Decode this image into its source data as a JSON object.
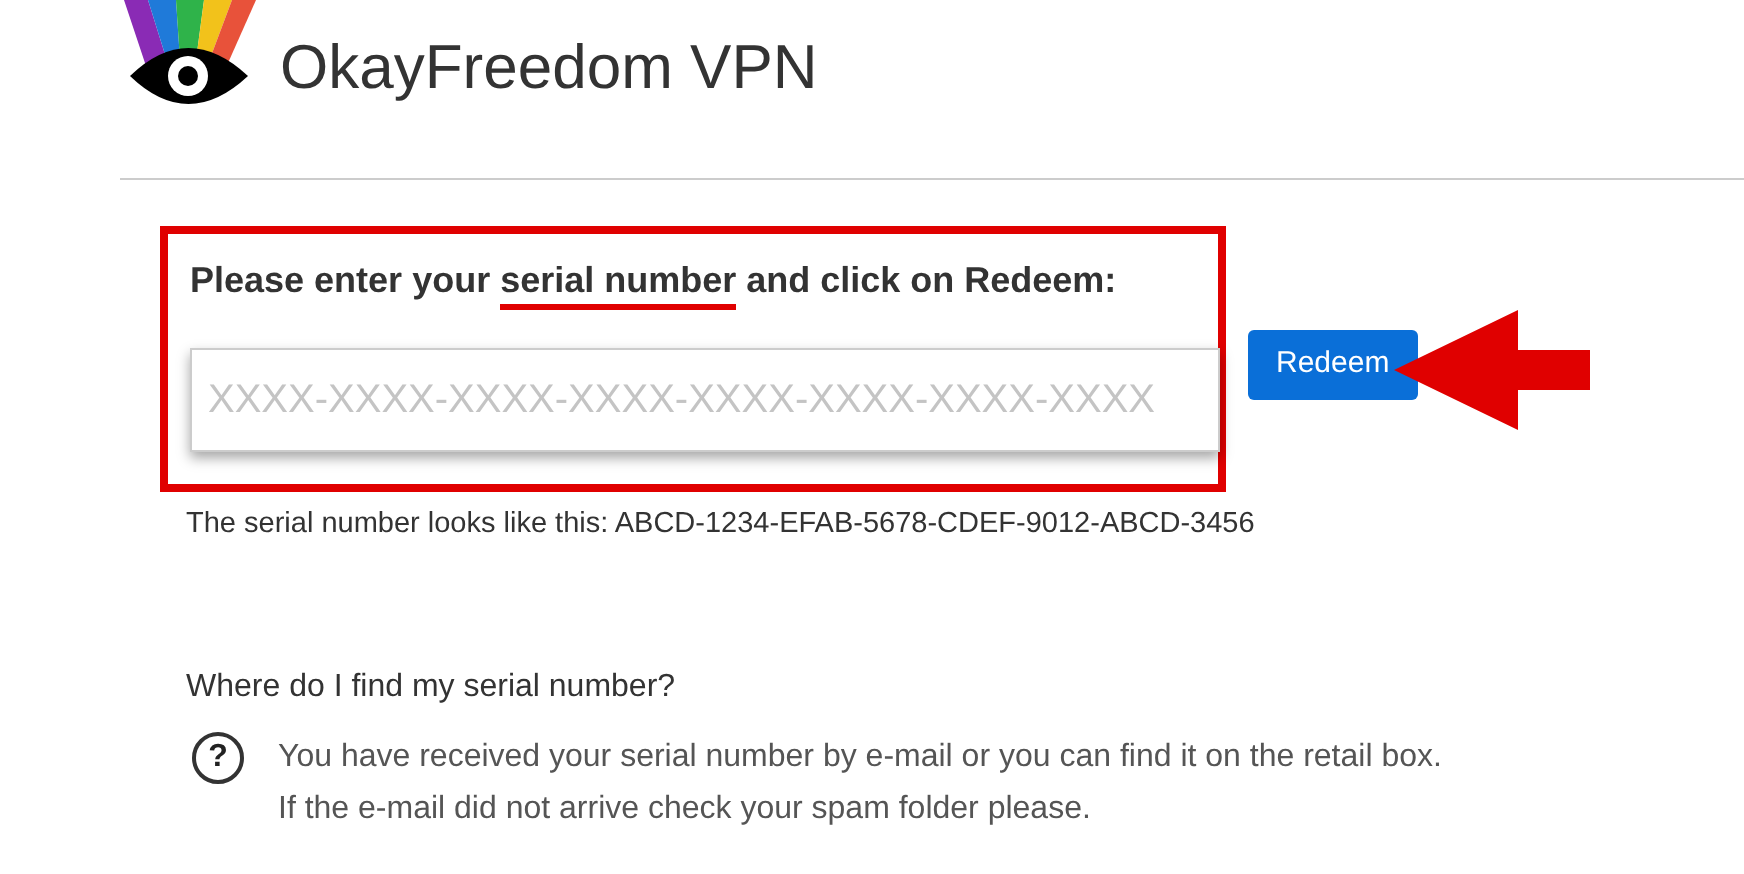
{
  "header": {
    "title": "OkayFreedom VPN"
  },
  "redeem": {
    "heading": [
      {
        "text": "Please enter your ",
        "marked": false
      },
      {
        "text": "serial number",
        "marked": true
      },
      {
        "text": " and click on Redeem:",
        "marked": false
      }
    ],
    "highlighted": true,
    "serial_field": {
      "placeholder": "XXXX-XXXX-XXXX-XXXX-XXXX-XXXX-XXXX-XXXX"
    },
    "button": "Redeem",
    "pointer_arrow": true,
    "hint": "The serial number looks like this: ABCD-1234-EFAB-5678-CDEF-9012-ABCD-3456"
  },
  "help": {
    "question": "Where do I find my serial number?",
    "icon": "?",
    "lines": [
      "You have received your serial number by e-mail or you can find it on the retail box.",
      "If the e-mail did not arrive check your spam folder please."
    ]
  }
}
